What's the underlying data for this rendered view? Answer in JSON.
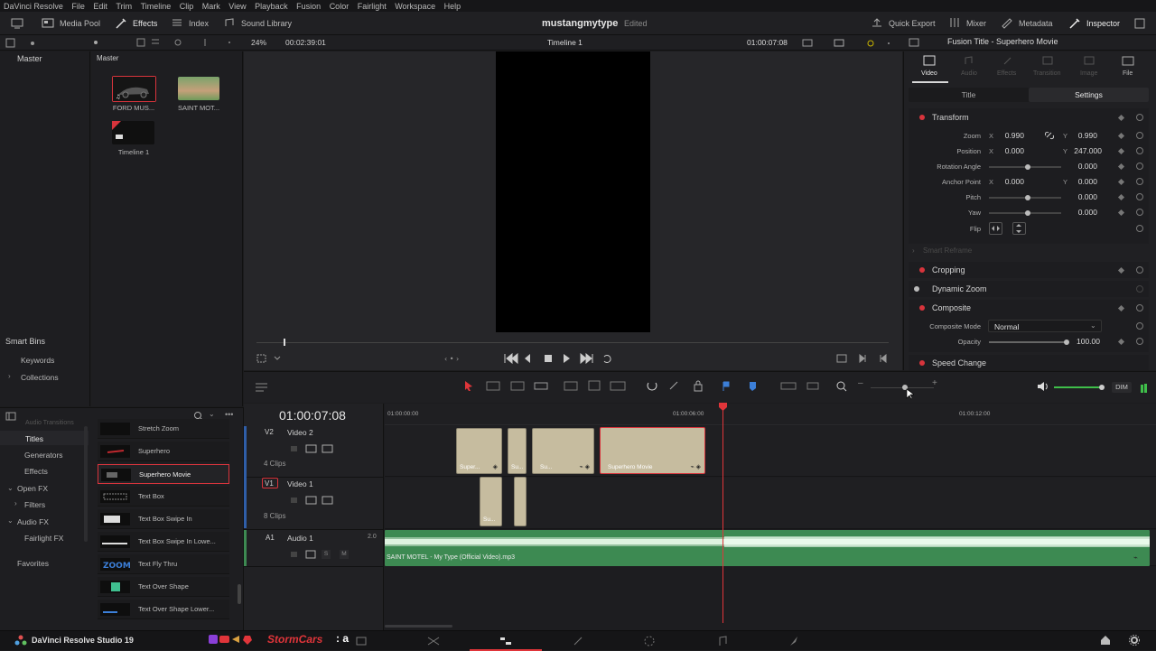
{
  "menu": [
    "DaVinci Resolve",
    "File",
    "Edit",
    "Trim",
    "Timeline",
    "Clip",
    "Mark",
    "View",
    "Playback",
    "Fusion",
    "Color",
    "Fairlight",
    "Workspace",
    "Help"
  ],
  "toolbar": {
    "media_pool": "Media Pool",
    "effects": "Effects",
    "index": "Index",
    "sound_library": "Sound Library",
    "project": "mustangmytype",
    "edited": "Edited",
    "quick_export": "Quick Export",
    "mixer": "Mixer",
    "metadata": "Metadata",
    "inspector": "Inspector"
  },
  "viewer": {
    "zoom": "24%",
    "duration": "00:02:39:01",
    "timeline_name": "Timeline 1",
    "timecode": "01:00:07:08"
  },
  "media_pool": {
    "bin": "Master",
    "left_title": "Master",
    "clips": [
      {
        "name": "FORD MUS..."
      },
      {
        "name": "SAINT MOT..."
      },
      {
        "name": "Timeline 1"
      }
    ]
  },
  "smart_bins": {
    "title": "Smart Bins",
    "items": [
      "Keywords",
      "Collections"
    ]
  },
  "effects_panel": {
    "categories": [
      "Titles",
      "Generators",
      "Effects",
      "Open FX",
      "Filters",
      "Audio FX",
      "Fairlight FX"
    ],
    "favorites": "Favorites",
    "header_hint": "Audio Transitions",
    "items": [
      "Stretch Zoom",
      "Superhero",
      "Superhero Movie",
      "Text Box",
      "Text Box Swipe In",
      "Text Box Swipe In Lowe...",
      "Text Fly Thru",
      "Text Over Shape",
      "Text Over Shape Lower..."
    ]
  },
  "inspector": {
    "title": "Fusion Title - Superhero Movie",
    "tabs": [
      "Video",
      "Audio",
      "Effects",
      "Transition",
      "Image",
      "File"
    ],
    "subtabs": [
      "Title",
      "Settings"
    ],
    "transform": "Transform",
    "zoom_label": "Zoom",
    "zoom_x": "0.990",
    "zoom_y": "0.990",
    "position_label": "Position",
    "position_x": "0.000",
    "position_y": "247.000",
    "rotation_label": "Rotation Angle",
    "rotation": "0.000",
    "anchor_label": "Anchor Point",
    "anchor_x": "0.000",
    "anchor_y": "0.000",
    "pitch_label": "Pitch",
    "pitch": "0.000",
    "yaw_label": "Yaw",
    "yaw": "0.000",
    "flip_label": "Flip",
    "smart_reframe": "Smart Reframe",
    "cropping": "Cropping",
    "dynamic_zoom": "Dynamic Zoom",
    "composite": "Composite",
    "composite_mode_label": "Composite Mode",
    "composite_mode": "Normal",
    "opacity_label": "Opacity",
    "opacity": "100.00",
    "speed_change": "Speed Change",
    "x": "X",
    "y": "Y"
  },
  "timeline": {
    "timecode": "01:00:07:08",
    "ruler": [
      "01:00:00:00",
      "01:00:06:00",
      "01:00:12:00"
    ],
    "tracks": [
      {
        "id": "V2",
        "name": "Video 2",
        "clips": "4 Clips"
      },
      {
        "id": "V1",
        "name": "Video 1",
        "clips": "8 Clips"
      },
      {
        "id": "A1",
        "name": "Audio 1",
        "channels": "2.0"
      }
    ],
    "clip_labels": [
      "Super...",
      "Su...",
      "Su...",
      "Superhero Movie",
      "Su..."
    ],
    "audio_clip": "SAINT MOTEL - My Type (Official Video).mp3",
    "dim": "DIM",
    "s": "S",
    "m": "M"
  },
  "taskbar": {
    "app": "DaVinci Resolve Studio 19",
    "overlay": "StormCars"
  },
  "colors": {
    "accent_red": "#d8343c",
    "clip": "#c6bc9f",
    "audio": "#3d8a52",
    "playhead": "#e0353a"
  }
}
